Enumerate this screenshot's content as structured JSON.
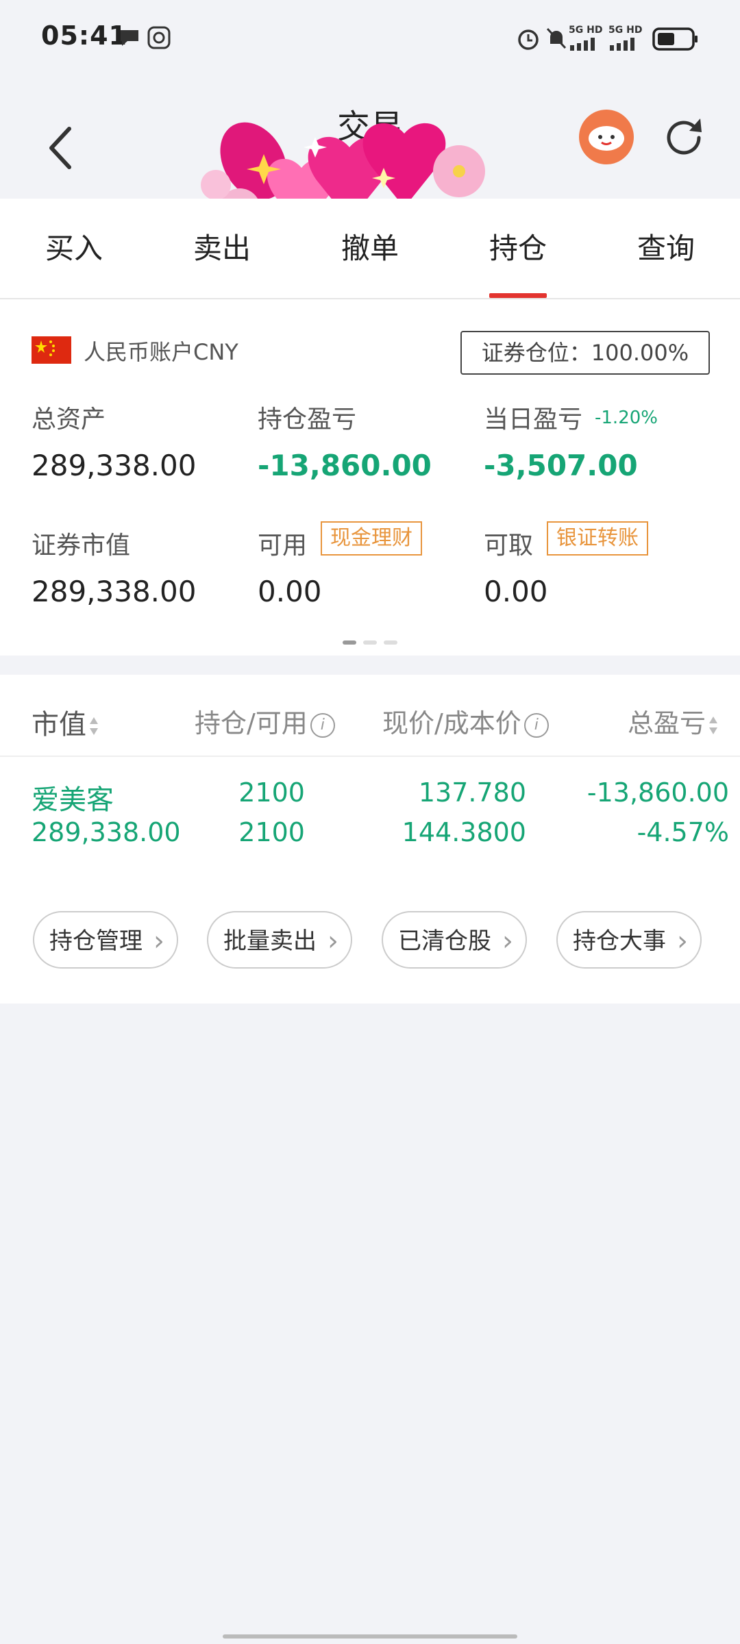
{
  "status_bar": {
    "time": "05:41",
    "net1": "5G HD",
    "net2": "5G HD"
  },
  "header": {
    "title": "交易"
  },
  "tabs": [
    "买入",
    "卖出",
    "撤单",
    "持仓",
    "查询"
  ],
  "active_tab": "持仓",
  "account": {
    "label": "人民币账户CNY",
    "position_ratio": "证券仓位：100.00%",
    "total_assets_label": "总资产",
    "total_assets": "289,338.00",
    "holding_pl_label": "持仓盈亏",
    "holding_pl": "-13,860.00",
    "daily_pl_label": "当日盈亏",
    "daily_pl_pct": "-1.20%",
    "daily_pl": "-3,507.00",
    "market_value_label": "证券市值",
    "market_value": "289,338.00",
    "available_label": "可用",
    "available_tag": "现金理财",
    "available": "0.00",
    "withdrawable_label": "可取",
    "withdrawable_tag": "银证转账",
    "withdrawable": "0.00"
  },
  "holdings": {
    "columns": [
      "市值",
      "持仓/可用",
      "现价/成本价",
      "总盈亏"
    ],
    "rows": [
      {
        "name": "爱美客",
        "market_value": "289,338.00",
        "position": "2100",
        "available": "2100",
        "current_price": "137.780",
        "cost_price": "144.3800",
        "total_pl": "-13,860.00",
        "total_pl_pct": "-4.57%"
      }
    ],
    "actions": [
      "持仓管理",
      "批量卖出",
      "已清仓股",
      "持仓大事"
    ]
  },
  "colors": {
    "accent_red": "#e3342f",
    "loss_green": "#16a575",
    "tag_orange": "#e8953d"
  }
}
